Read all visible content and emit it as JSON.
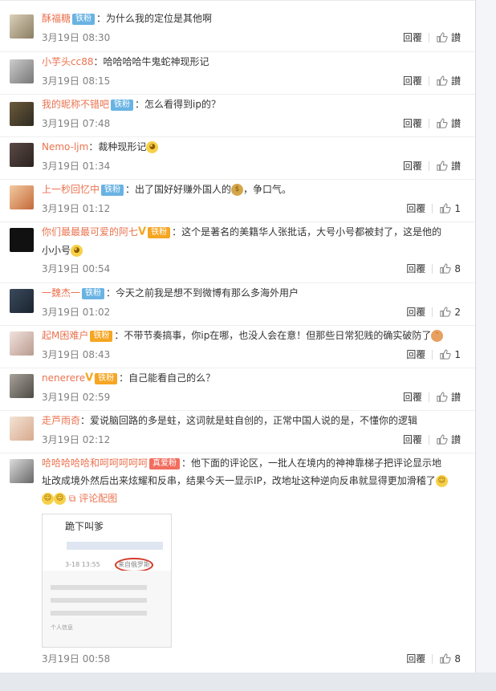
{
  "comments": [
    {
      "user": "酥福糖",
      "badge": "铁粉",
      "text": "：为什么我的定位是其他啊",
      "time": "3月19日 08:30",
      "reply": "回覆",
      "like": "",
      "like_label": "讃"
    },
    {
      "user": "小芋头cc88",
      "badge": "",
      "text": "：哈哈哈哈牛鬼蛇神现形记",
      "time": "3月19日 08:15",
      "reply": "回覆",
      "like": "",
      "like_label": "讃"
    },
    {
      "user": "我的昵称不错吧",
      "badge": "铁粉",
      "text": "：怎么看得到ip的？",
      "time": "3月19日 07:48",
      "reply": "回覆",
      "like": "",
      "like_label": "讃"
    },
    {
      "user": "Nemo-ljm",
      "badge": "",
      "text": "：裁种现形记",
      "time": "3月19日 01:34",
      "reply": "回覆",
      "like": "",
      "like_label": "讃"
    },
    {
      "user": "上一秒回忆中",
      "badge": "铁粉",
      "text": "：出了国好好赚外国人的",
      "text2": "，争口气。",
      "time": "3月19日 01:12",
      "reply": "回覆",
      "like": "1",
      "like_label": ""
    },
    {
      "user": "你们最最最可爱的阿七",
      "badge": "铁粉",
      "text": "：这个是著名的美籍华人张批话，大号小号都被封了，这是他的",
      "text2": "小小号",
      "time": "3月19日 00:54",
      "reply": "回覆",
      "like": "8",
      "like_label": ""
    },
    {
      "user": "一魏杰一",
      "badge": "铁粉",
      "text": "：今天之前我是想不到微博有那么多海外用户",
      "time": "3月19日 01:02",
      "reply": "回覆",
      "like": "2",
      "like_label": ""
    },
    {
      "user": "起M困难户",
      "badge": "铁粉",
      "text": "：不带节奏搞事，你ip在哪，也没人会在意！但那些日常犯贱的确实破防了",
      "time": "3月19日 08:43",
      "reply": "回覆",
      "like": "1",
      "like_label": ""
    },
    {
      "user": "nenerere",
      "badge": "铁粉",
      "text": "：自己能看自己的么？",
      "time": "3月19日 02:59",
      "reply": "回覆",
      "like": "",
      "like_label": "讃"
    },
    {
      "user": "走芦雨奇",
      "badge": "",
      "text": "：爱说脑回路的多是蛀，这词就是蛀自创的，正常中国人说的是，不懂你的逻辑",
      "time": "3月19日 02:12",
      "reply": "回覆",
      "like": "",
      "like_label": "讃"
    },
    {
      "user": "哈哈哈哈哈和呵呵呵呵呵",
      "badge": "真爱粉",
      "text": "：他下面的评论区，一批人在境内的神神靠梯子把评论显示地",
      "text2": "址改成境外然后出来炫耀和反串，结果今天一显示IP，改地址这种逆向反串就显得更加滑稽了",
      "img_link": "评论配图",
      "time": "3月19日 00:58",
      "reply": "回覆",
      "like": "8",
      "like_label": ""
    }
  ],
  "attachment": {
    "line1": "跪下叫爹",
    "line2": "3-18 13:55",
    "line3": "来自俄罗斯",
    "line4": "个人信息"
  },
  "colors": {
    "username": "#eb7350",
    "badge": "#69b3e3",
    "meta": "#808080"
  }
}
